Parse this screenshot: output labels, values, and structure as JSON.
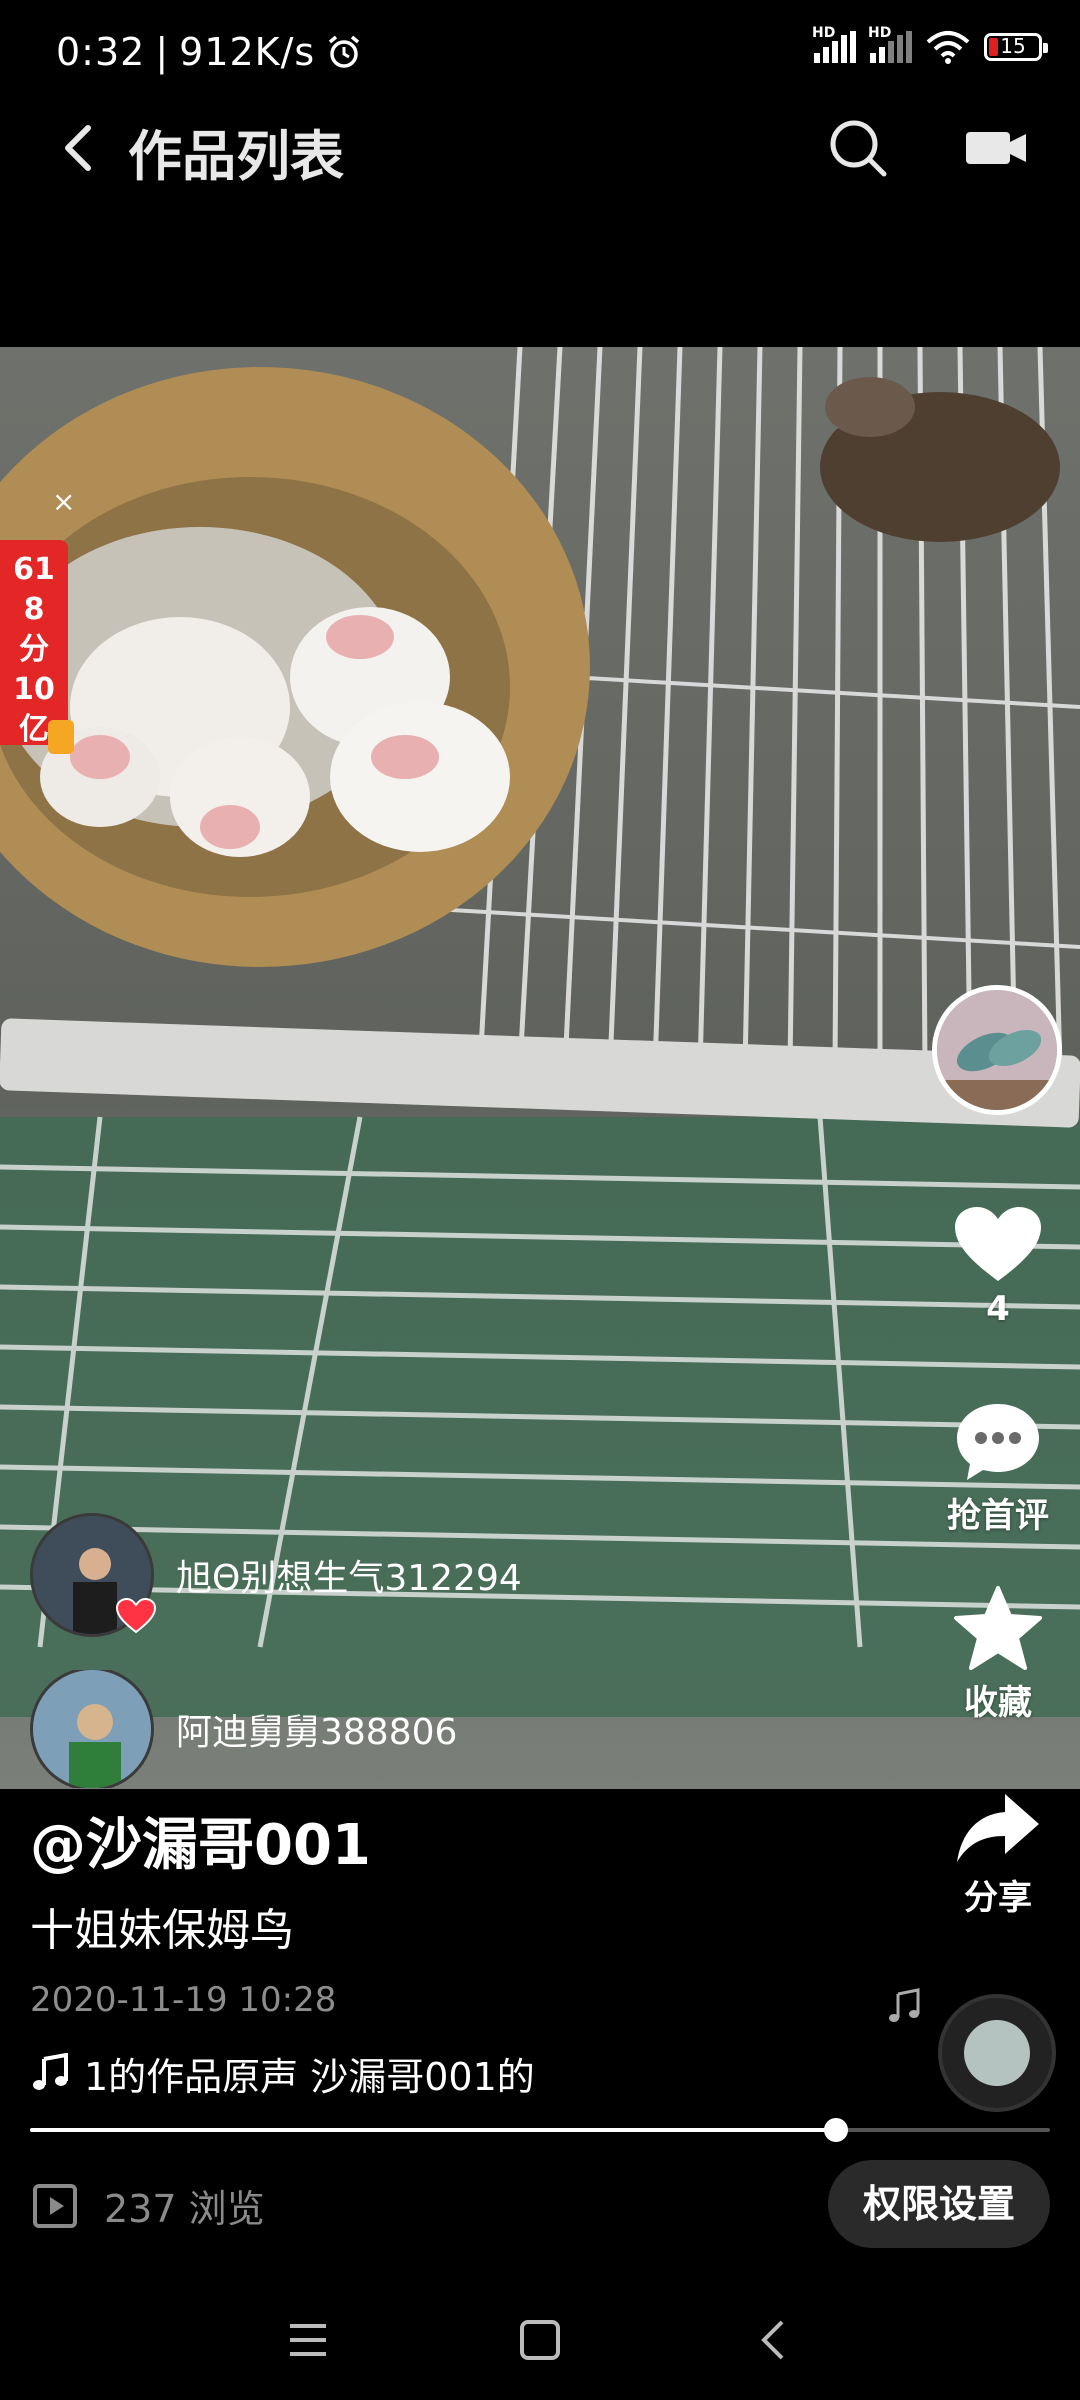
{
  "status_bar": {
    "time": "0:32",
    "separator": "|",
    "speed": "912K/s",
    "battery": "15",
    "hd_label": "HD",
    "icons": [
      "alarm-icon",
      "signal-icon",
      "signal-icon",
      "wifi-icon",
      "battery-icon"
    ]
  },
  "header": {
    "title": "作品列表",
    "icons": [
      "chevron-left-icon",
      "search-icon",
      "camera-icon"
    ]
  },
  "promo": {
    "text": "618分10亿",
    "close": "×"
  },
  "actions": {
    "like_count": "4",
    "comment_label": "抢首评",
    "favorite_label": "收藏",
    "share_label": "分享"
  },
  "commenters": [
    {
      "name": "旭Θ别想生气312294"
    },
    {
      "name": "阿迪舅舅388806"
    }
  ],
  "post": {
    "author": "@沙漏哥001",
    "caption": "十姐妹保姆鸟",
    "date": "2020-11-19 10:28",
    "music": "1的作品原声    沙漏哥001的"
  },
  "progress": {
    "fraction": 0.79
  },
  "footer": {
    "views": "237 浏览",
    "permission_button": "权限设置"
  },
  "colors": {
    "background": "#000000",
    "accent_red": "#e32727",
    "heart": "#ff3344"
  }
}
